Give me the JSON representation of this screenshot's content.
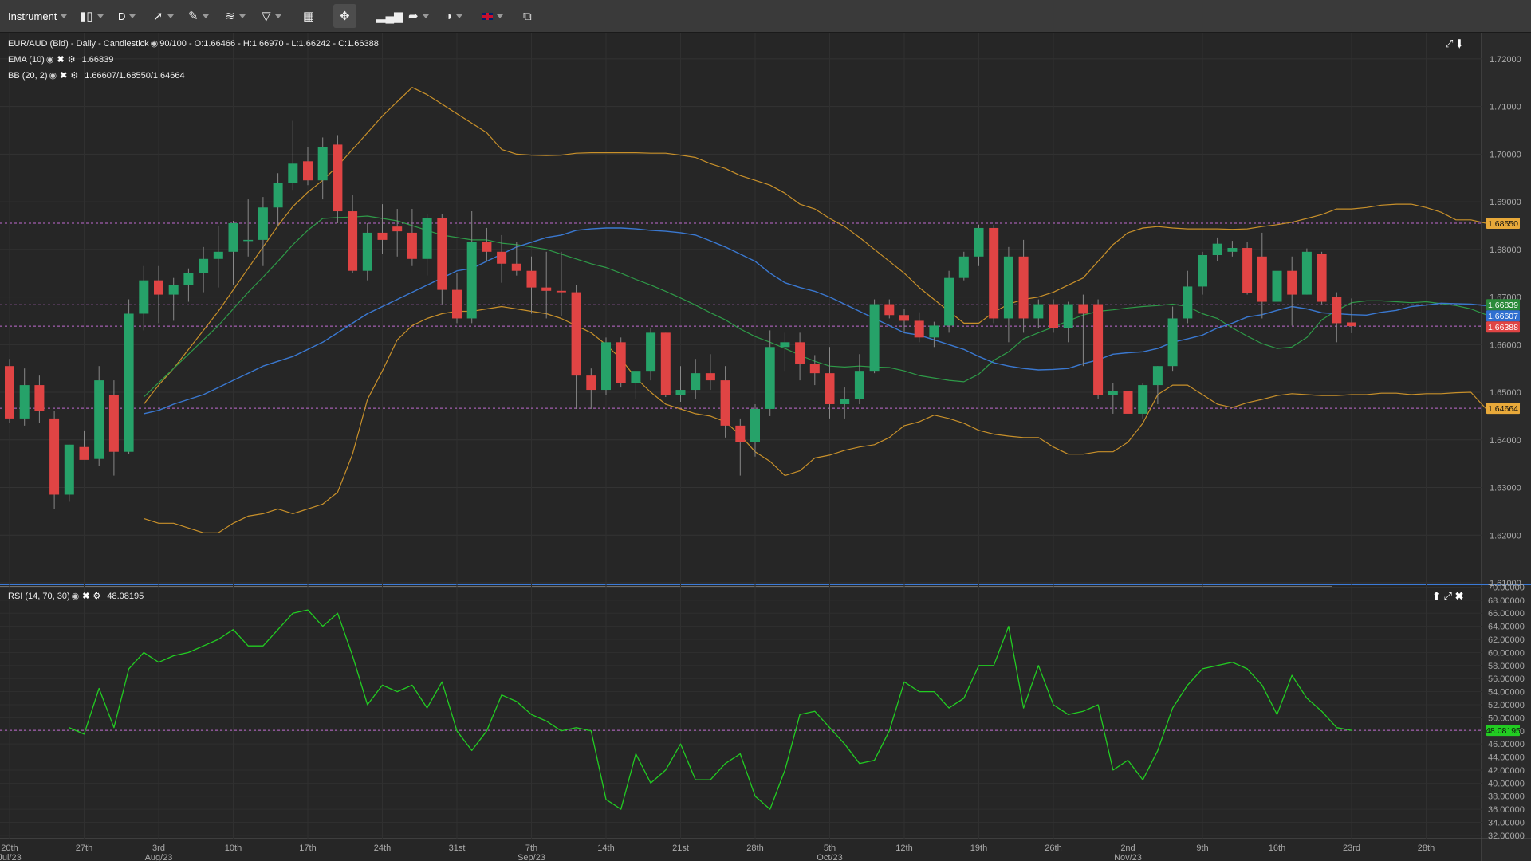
{
  "toolbar": {
    "instrument_label": "Instrument",
    "timeframe_label": "D"
  },
  "legend": {
    "main": "EUR/AUD (Bid) - Daily - Candlestick",
    "main_values": "90/100 - O:1.66466 - H:1.66970 - L:1.66242 - C:1.66388",
    "ema": "EMA (10)",
    "ema_value": "1.66839",
    "bb": "BB (20, 2)",
    "bb_value": "1.66607/1.68550/1.64664",
    "rsi": "RSI (14, 70, 30)",
    "rsi_value": "48.08195"
  },
  "colors": {
    "up": "#26a269",
    "down": "#e04444",
    "ema": "#3a78d0",
    "bb_band": "#c8902a",
    "bb_mid": "#2e9a48",
    "rsi": "#22cc22",
    "level": "#c06bd0"
  },
  "price_axis": {
    "ticks": [
      "1.72000",
      "1.71000",
      "1.70000",
      "1.69000",
      "1.68000",
      "1.67000",
      "1.66000",
      "1.65000",
      "1.64000",
      "1.63000",
      "1.62000",
      "1.61000"
    ],
    "tick_values": [
      1.72,
      1.71,
      1.7,
      1.69,
      1.68,
      1.67,
      1.66,
      1.65,
      1.64,
      1.63,
      1.62,
      1.61
    ],
    "range": [
      1.61,
      1.7245
    ],
    "tags": [
      {
        "text": "1.68550",
        "value": 1.6855,
        "bg": "#e8a93a",
        "fg": "#111"
      },
      {
        "text": "1.66839",
        "value": 1.66839,
        "bg": "#2a8a3a",
        "fg": "#fff"
      },
      {
        "text": "1.66607",
        "value": 1.66607,
        "bg": "#2f6fd0",
        "fg": "#fff"
      },
      {
        "text": "1.66388",
        "value": 1.66388,
        "bg": "#e04444",
        "fg": "#fff"
      },
      {
        "text": "1.64664",
        "value": 1.64664,
        "bg": "#e8a93a",
        "fg": "#111"
      }
    ],
    "levels": [
      1.6855,
      1.66839,
      1.66388,
      1.64664
    ]
  },
  "rsi_axis": {
    "ticks": [
      "70.00000",
      "68.00000",
      "66.00000",
      "64.00000",
      "62.00000",
      "60.00000",
      "58.00000",
      "56.00000",
      "54.00000",
      "52.00000",
      "50.00000",
      "48.00000",
      "46.00000",
      "44.00000",
      "42.00000",
      "40.00000",
      "38.00000",
      "36.00000",
      "34.00000",
      "32.00000"
    ],
    "tick_values": [
      70,
      68,
      66,
      64,
      62,
      60,
      58,
      56,
      54,
      52,
      50,
      48,
      46,
      44,
      42,
      40,
      38,
      36,
      34,
      32
    ],
    "range": [
      31.5,
      70.3
    ],
    "tag": {
      "text": "48.08195",
      "value": 48.08195,
      "bg": "#22cc22",
      "fg": "#111"
    },
    "level": 48.08195
  },
  "x_axis": {
    "labels": [
      {
        "i": 0,
        "top": "20th",
        "bottom": "Jul/23"
      },
      {
        "i": 5,
        "top": "27th",
        "bottom": ""
      },
      {
        "i": 10,
        "top": "3rd",
        "bottom": "Aug/23"
      },
      {
        "i": 15,
        "top": "10th",
        "bottom": ""
      },
      {
        "i": 20,
        "top": "17th",
        "bottom": ""
      },
      {
        "i": 25,
        "top": "24th",
        "bottom": ""
      },
      {
        "i": 30,
        "top": "31st",
        "bottom": ""
      },
      {
        "i": 35,
        "top": "7th",
        "bottom": "Sep/23"
      },
      {
        "i": 40,
        "top": "14th",
        "bottom": ""
      },
      {
        "i": 45,
        "top": "21st",
        "bottom": ""
      },
      {
        "i": 50,
        "top": "28th",
        "bottom": ""
      },
      {
        "i": 55,
        "top": "5th",
        "bottom": "Oct/23"
      },
      {
        "i": 60,
        "top": "12th",
        "bottom": ""
      },
      {
        "i": 65,
        "top": "19th",
        "bottom": ""
      },
      {
        "i": 70,
        "top": "26th",
        "bottom": ""
      },
      {
        "i": 75,
        "top": "2nd",
        "bottom": "Nov/23"
      },
      {
        "i": 80,
        "top": "9th",
        "bottom": ""
      },
      {
        "i": 85,
        "top": "16th",
        "bottom": ""
      },
      {
        "i": 90,
        "top": "23rd",
        "bottom": ""
      },
      {
        "i": 95,
        "top": "28th",
        "bottom": ""
      }
    ]
  },
  "chart_data": {
    "type": "candlestick",
    "title": "EUR/AUD (Bid) - Daily - Candlestick",
    "candles": [
      [
        1.6555,
        1.657,
        1.6435,
        1.6445
      ],
      [
        1.6445,
        1.655,
        1.643,
        1.6515
      ],
      [
        1.6515,
        1.6535,
        1.6435,
        1.646
      ],
      [
        1.6445,
        1.646,
        1.6255,
        1.6285
      ],
      [
        1.6285,
        1.639,
        1.627,
        1.639
      ],
      [
        1.6385,
        1.642,
        1.636,
        1.6358
      ],
      [
        1.636,
        1.6555,
        1.6345,
        1.6525
      ],
      [
        1.6495,
        1.6525,
        1.6325,
        1.6375
      ],
      [
        1.6375,
        1.6695,
        1.637,
        1.6665
      ],
      [
        1.6665,
        1.6765,
        1.663,
        1.6735
      ],
      [
        1.6735,
        1.6765,
        1.6645,
        1.6705
      ],
      [
        1.6705,
        1.674,
        1.665,
        1.6725
      ],
      [
        1.6725,
        1.676,
        1.669,
        1.675
      ],
      [
        1.675,
        1.6805,
        1.671,
        1.678
      ],
      [
        1.678,
        1.685,
        1.672,
        1.6795
      ],
      [
        1.6795,
        1.686,
        1.6725,
        1.6855
      ],
      [
        1.682,
        1.6905,
        1.6785,
        1.682
      ],
      [
        1.682,
        1.691,
        1.6765,
        1.6888
      ],
      [
        1.6888,
        1.696,
        1.685,
        1.694
      ],
      [
        1.694,
        1.707,
        1.6925,
        1.698
      ],
      [
        1.6985,
        1.7015,
        1.6935,
        1.6945
      ],
      [
        1.6945,
        1.7035,
        1.6905,
        1.7015
      ],
      [
        1.702,
        1.704,
        1.6855,
        1.688
      ],
      [
        1.688,
        1.6915,
        1.675,
        1.6755
      ],
      [
        1.6755,
        1.6855,
        1.6735,
        1.6835
      ],
      [
        1.6835,
        1.6895,
        1.679,
        1.682
      ],
      [
        1.6848,
        1.6885,
        1.6785,
        1.6838
      ],
      [
        1.6835,
        1.6885,
        1.6765,
        1.678
      ],
      [
        1.678,
        1.6875,
        1.6745,
        1.6865
      ],
      [
        1.6865,
        1.6875,
        1.6685,
        1.6715
      ],
      [
        1.6715,
        1.675,
        1.6645,
        1.6655
      ],
      [
        1.6655,
        1.688,
        1.6645,
        1.6815
      ],
      [
        1.6815,
        1.6845,
        1.6775,
        1.6795
      ],
      [
        1.6795,
        1.683,
        1.673,
        1.677
      ],
      [
        1.677,
        1.6815,
        1.6745,
        1.6755
      ],
      [
        1.6755,
        1.6785,
        1.6665,
        1.672
      ],
      [
        1.672,
        1.6795,
        1.6655,
        1.6713
      ],
      [
        1.6713,
        1.6795,
        1.666,
        1.671
      ],
      [
        1.671,
        1.6725,
        1.6465,
        1.6535
      ],
      [
        1.6535,
        1.655,
        1.6465,
        1.6505
      ],
      [
        1.6505,
        1.6615,
        1.6495,
        1.6605
      ],
      [
        1.6605,
        1.6615,
        1.651,
        1.652
      ],
      [
        1.652,
        1.6545,
        1.6485,
        1.6545
      ],
      [
        1.6545,
        1.6635,
        1.6525,
        1.6625
      ],
      [
        1.6625,
        1.6625,
        1.649,
        1.6495
      ],
      [
        1.6495,
        1.6555,
        1.648,
        1.6505
      ],
      [
        1.6505,
        1.657,
        1.6485,
        1.654
      ],
      [
        1.654,
        1.658,
        1.6505,
        1.6525
      ],
      [
        1.6525,
        1.6555,
        1.6405,
        1.643
      ],
      [
        1.643,
        1.6445,
        1.6325,
        1.6395
      ],
      [
        1.6395,
        1.6475,
        1.6365,
        1.6465
      ],
      [
        1.6465,
        1.663,
        1.645,
        1.6595
      ],
      [
        1.6595,
        1.6625,
        1.6545,
        1.6605
      ],
      [
        1.6605,
        1.6625,
        1.6525,
        1.656
      ],
      [
        1.656,
        1.6578,
        1.6515,
        1.654
      ],
      [
        1.654,
        1.6595,
        1.6445,
        1.6475
      ],
      [
        1.6475,
        1.651,
        1.6445,
        1.6485
      ],
      [
        1.6485,
        1.658,
        1.6475,
        1.6545
      ],
      [
        1.6545,
        1.6695,
        1.654,
        1.6685
      ],
      [
        1.6685,
        1.6695,
        1.6655,
        1.6662
      ],
      [
        1.6662,
        1.6675,
        1.6625,
        1.665
      ],
      [
        1.665,
        1.6668,
        1.6605,
        1.6615
      ],
      [
        1.6615,
        1.6648,
        1.6595,
        1.664
      ],
      [
        1.664,
        1.6755,
        1.6625,
        1.674
      ],
      [
        1.674,
        1.6795,
        1.6735,
        1.6785
      ],
      [
        1.6785,
        1.6852,
        1.6765,
        1.6845
      ],
      [
        1.6845,
        1.6852,
        1.6645,
        1.6655
      ],
      [
        1.6655,
        1.6805,
        1.6605,
        1.6785
      ],
      [
        1.6785,
        1.682,
        1.6625,
        1.6655
      ],
      [
        1.6655,
        1.6695,
        1.6635,
        1.6685
      ],
      [
        1.6685,
        1.6695,
        1.6625,
        1.6635
      ],
      [
        1.6635,
        1.669,
        1.6605,
        1.6685
      ],
      [
        1.6685,
        1.6705,
        1.6555,
        1.6665
      ],
      [
        1.6685,
        1.6695,
        1.6485,
        1.6495
      ],
      [
        1.6495,
        1.652,
        1.6455,
        1.6502
      ],
      [
        1.6502,
        1.6512,
        1.6445,
        1.6455
      ],
      [
        1.6455,
        1.652,
        1.6445,
        1.6515
      ],
      [
        1.6515,
        1.6555,
        1.6475,
        1.6555
      ],
      [
        1.6555,
        1.668,
        1.6545,
        1.6655
      ],
      [
        1.6655,
        1.6755,
        1.6645,
        1.6722
      ],
      [
        1.6722,
        1.6795,
        1.6705,
        1.6788
      ],
      [
        1.6788,
        1.6825,
        1.6775,
        1.6812
      ],
      [
        1.6795,
        1.6818,
        1.6785,
        1.6803
      ],
      [
        1.6803,
        1.6815,
        1.6705,
        1.6708
      ],
      [
        1.6785,
        1.6835,
        1.6655,
        1.669
      ],
      [
        1.669,
        1.6795,
        1.6675,
        1.6755
      ],
      [
        1.6755,
        1.6785,
        1.664,
        1.6705
      ],
      [
        1.6705,
        1.6802,
        1.6705,
        1.6795
      ],
      [
        1.679,
        1.6795,
        1.6685,
        1.669
      ],
      [
        1.67,
        1.671,
        1.6605,
        1.6645
      ],
      [
        1.66466,
        1.6697,
        1.66242,
        1.66388
      ]
    ],
    "ema_start": 9,
    "ema": [
      1.6455,
      1.6462,
      1.6475,
      1.6485,
      1.6495,
      1.651,
      1.6525,
      1.654,
      1.6555,
      1.6565,
      1.6575,
      1.659,
      1.6605,
      1.6625,
      1.6645,
      1.6665,
      1.668,
      1.6695,
      1.671,
      1.6725,
      1.674,
      1.6755,
      1.676,
      1.6775,
      1.679,
      1.6805,
      1.6815,
      1.6825,
      1.683,
      1.684,
      1.6843,
      1.6845,
      1.6845,
      1.6843,
      1.684,
      1.6838,
      1.6835,
      1.683,
      1.6818,
      1.6805,
      1.679,
      1.6775,
      1.675,
      1.673,
      1.672,
      1.6712,
      1.67,
      1.6685,
      1.667,
      1.6655,
      1.664,
      1.6625,
      1.662,
      1.661,
      1.66,
      1.659,
      1.6575,
      1.6562,
      1.6555,
      1.655,
      1.6547,
      1.6548,
      1.655,
      1.656,
      1.6568,
      1.658,
      1.6583,
      1.6585,
      1.6592,
      1.6605,
      1.6612,
      1.662,
      1.6635,
      1.6645,
      1.6658,
      1.6663,
      1.6672,
      1.668,
      1.6675,
      1.6667,
      1.6665,
      1.6663,
      1.6662,
      1.6668,
      1.6672,
      1.668,
      1.6683,
      1.6687,
      1.6686,
      1.6685,
      1.6682
    ],
    "bb_start": 9,
    "bb_upper": [
      1.6475,
      1.6515,
      1.655,
      1.659,
      1.663,
      1.667,
      1.6715,
      1.676,
      1.6805,
      1.685,
      1.689,
      1.692,
      1.6945,
      1.6975,
      1.701,
      1.7045,
      1.708,
      1.711,
      1.714,
      1.7125,
      1.7105,
      1.7085,
      1.7065,
      1.7045,
      1.701,
      1.7,
      1.6998,
      1.6997,
      1.6998,
      1.7002,
      1.7003,
      1.7003,
      1.7003,
      1.7003,
      1.7002,
      1.7002,
      1.6998,
      1.6993,
      1.698,
      1.697,
      1.6955,
      1.6945,
      1.6935,
      1.6918,
      1.6895,
      1.6885,
      1.6865,
      1.6848,
      1.6825,
      1.68,
      1.6775,
      1.675,
      1.672,
      1.6695,
      1.667,
      1.6645,
      1.6645,
      1.6668,
      1.6685,
      1.6695,
      1.67,
      1.671,
      1.6725,
      1.674,
      1.6775,
      1.681,
      1.6835,
      1.6845,
      1.6848,
      1.6845,
      1.6843,
      1.6843,
      1.6843,
      1.6842,
      1.6843,
      1.6848,
      1.6852,
      1.6857,
      1.6865,
      1.6873,
      1.6885,
      1.6885,
      1.6888,
      1.6893,
      1.6895,
      1.6895,
      1.6888,
      1.6878,
      1.6862,
      1.6862,
      1.6855
    ],
    "bb_mid": [
      1.649,
      1.652,
      1.655,
      1.658,
      1.661,
      1.664,
      1.6675,
      1.671,
      1.6742,
      1.6775,
      1.681,
      1.684,
      1.6865,
      1.6867,
      1.6868,
      1.687,
      1.6865,
      1.686,
      1.685,
      1.684,
      1.683,
      1.6825,
      1.682,
      1.682,
      1.6813,
      1.681,
      1.6805,
      1.68,
      1.679,
      1.678,
      1.677,
      1.6762,
      1.675,
      1.6737,
      1.6725,
      1.6712,
      1.6698,
      1.6683,
      1.6667,
      1.6652,
      1.6633,
      1.6617,
      1.6605,
      1.6592,
      1.6578,
      1.6565,
      1.6555,
      1.6553,
      1.6555,
      1.6553,
      1.6552,
      1.6545,
      1.6535,
      1.653,
      1.6525,
      1.6522,
      1.6538,
      1.6567,
      1.6585,
      1.6612,
      1.6625,
      1.6637,
      1.665,
      1.6662,
      1.667,
      1.6673,
      1.6677,
      1.668,
      1.6682,
      1.6685,
      1.668,
      1.6665,
      1.6655,
      1.6635,
      1.6618,
      1.6602,
      1.6592,
      1.6595,
      1.6615,
      1.6652,
      1.6672,
      1.6688,
      1.6692,
      1.6692,
      1.669,
      1.6688,
      1.669,
      1.6686,
      1.6682,
      1.6675,
      1.6663
    ],
    "bb_lower": [
      1.6235,
      1.6225,
      1.6225,
      1.6215,
      1.6205,
      1.6205,
      1.6225,
      1.624,
      1.6245,
      1.6255,
      1.6245,
      1.6255,
      1.6265,
      1.629,
      1.637,
      1.6485,
      1.6545,
      1.661,
      1.664,
      1.6655,
      1.6665,
      1.667,
      1.667,
      1.6675,
      1.668,
      1.6675,
      1.667,
      1.6665,
      1.6655,
      1.664,
      1.6625,
      1.66,
      1.657,
      1.653,
      1.65,
      1.6475,
      1.6465,
      1.6455,
      1.645,
      1.6438,
      1.641,
      1.6375,
      1.6355,
      1.6325,
      1.6335,
      1.6362,
      1.6368,
      1.6378,
      1.6385,
      1.639,
      1.6405,
      1.643,
      1.6438,
      1.6452,
      1.6445,
      1.6435,
      1.642,
      1.6412,
      1.6408,
      1.6405,
      1.6405,
      1.6385,
      1.637,
      1.637,
      1.6375,
      1.6375,
      1.6395,
      1.6435,
      1.6495,
      1.6515,
      1.6515,
      1.6495,
      1.6475,
      1.6468,
      1.6478,
      1.6485,
      1.6493,
      1.6497,
      1.6495,
      1.6493,
      1.6493,
      1.6495,
      1.6495,
      1.6498,
      1.6498,
      1.6495,
      1.6497,
      1.6497,
      1.6499,
      1.65,
      1.6466
    ],
    "rsi_start": 4,
    "rsi": [
      48.5,
      47.5,
      54.5,
      48.5,
      57.5,
      60.0,
      58.5,
      59.5,
      60.0,
      61.0,
      62.0,
      63.5,
      61.0,
      61.0,
      63.5,
      66.0,
      66.5,
      64.0,
      66.0,
      59.5,
      52.0,
      55.0,
      54.0,
      55.0,
      51.5,
      55.5,
      48.0,
      45.0,
      48.0,
      53.5,
      52.5,
      50.5,
      49.5,
      48.0,
      48.5,
      48.0,
      37.5,
      36.0,
      44.5,
      40.0,
      42.0,
      46.0,
      40.5,
      40.5,
      43.0,
      44.5,
      38.0,
      36.0,
      42.0,
      50.5,
      51.0,
      48.5,
      46.0,
      43.0,
      43.5,
      48.0,
      55.5,
      54.0,
      54.0,
      51.5,
      53.0,
      58.0,
      58.0,
      64.0,
      51.5,
      58.0,
      52.0,
      50.5,
      51.0,
      52.0,
      42.0,
      43.5,
      40.5,
      45.0,
      51.5,
      55.0,
      57.5,
      58.0,
      58.5,
      57.5,
      55.0,
      50.5,
      56.5,
      53.0,
      51.0,
      48.5,
      48.08
    ]
  }
}
